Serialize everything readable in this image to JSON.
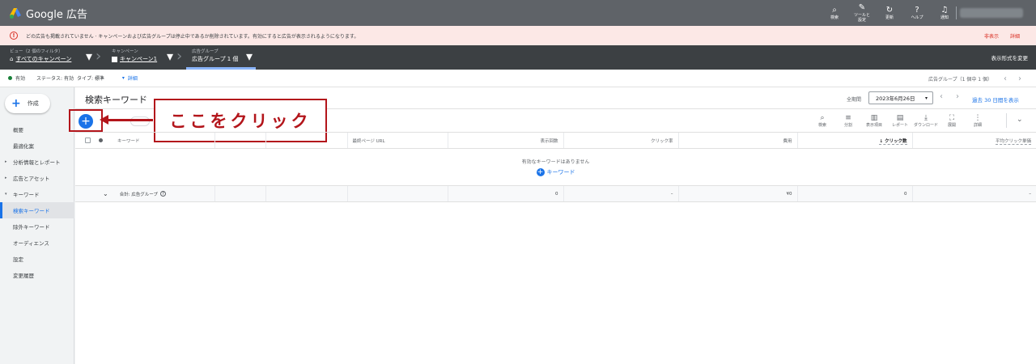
{
  "app": {
    "title": "Google 広告"
  },
  "topbar": {
    "icons": [
      {
        "name": "search",
        "glyph": "⌕",
        "label": "検索"
      },
      {
        "name": "tools",
        "glyph": "✎",
        "label": "ツールと\n設定"
      },
      {
        "name": "refresh",
        "glyph": "↻",
        "label": "更新"
      },
      {
        "name": "help",
        "glyph": "?",
        "label": "ヘルプ"
      },
      {
        "name": "notifications",
        "glyph": "♫",
        "label": "通知"
      }
    ]
  },
  "alert": {
    "message": "どの広告も掲載されていません · キャンペーンおよび広告グループは停止中であるか削除されています。有効にすると広告が表示されるようになります。",
    "dismiss": "非表示",
    "details": "詳細"
  },
  "breadcrumb": {
    "view": {
      "small": "ビュー（2 個のフィルタ）",
      "label": "すべてのキャンペーン"
    },
    "campaign": {
      "small": "キャンペーン",
      "label": "キャンペーン1"
    },
    "adgroup": {
      "small": "広告グループ",
      "label": "広告グループ 1 個"
    },
    "view_mode": "表示形式を変更"
  },
  "filters": {
    "status": "有効",
    "status_filter": "ステータス: 有効",
    "type_filter": "タイプ: 標準",
    "details": "詳細",
    "pager": "広告グループ（1 個中 1 個）"
  },
  "sidebar": {
    "create": "作成",
    "items": [
      {
        "label": "概要",
        "arrow": ""
      },
      {
        "label": "最適化案",
        "arrow": ""
      },
      {
        "label": "分析情報とレポート",
        "arrow": "▸"
      },
      {
        "label": "広告とアセット",
        "arrow": "▸"
      },
      {
        "label": "キーワード",
        "arrow": "▾"
      },
      {
        "label": "検索キーワード",
        "arrow": ""
      },
      {
        "label": "除外キーワード",
        "arrow": ""
      },
      {
        "label": "オーディエンス",
        "arrow": ""
      },
      {
        "label": "設定",
        "arrow": ""
      },
      {
        "label": "変更履歴",
        "arrow": ""
      }
    ]
  },
  "main": {
    "title": "検索キーワード",
    "period_label": "全期間",
    "date": "2023年6月26日",
    "last30": "過去 30 日間を表示"
  },
  "annotation": {
    "callout": "ここをクリック"
  },
  "toolbar": {
    "tools": [
      {
        "name": "search",
        "glyph": "⌕",
        "label": "検索"
      },
      {
        "name": "segment",
        "glyph": "≡",
        "label": "分割"
      },
      {
        "name": "columns",
        "glyph": "▥",
        "label": "表示項目"
      },
      {
        "name": "reports",
        "glyph": "▤",
        "label": "レポート"
      },
      {
        "name": "download",
        "glyph": "⤓",
        "label": "ダウンロード"
      },
      {
        "name": "expand",
        "glyph": "⛶",
        "label": "展開"
      },
      {
        "name": "more",
        "glyph": "⋮",
        "label": "詳細"
      }
    ]
  },
  "table": {
    "headers": {
      "keyword": "キーワード",
      "final_url": "最終ページ URL",
      "impressions": "表示回数",
      "ctr": "クリック率",
      "cost": "費用",
      "clicks": "↓ クリック数",
      "avg_cpc": "平均クリック単価"
    },
    "empty": {
      "message": "有効なキーワードはありません",
      "add": "キーワード"
    },
    "total": {
      "label": "合計: 広告グループ",
      "impressions": "0",
      "ctr": "–",
      "cost": "¥0",
      "clicks": "0",
      "avg_cpc": "–"
    }
  }
}
